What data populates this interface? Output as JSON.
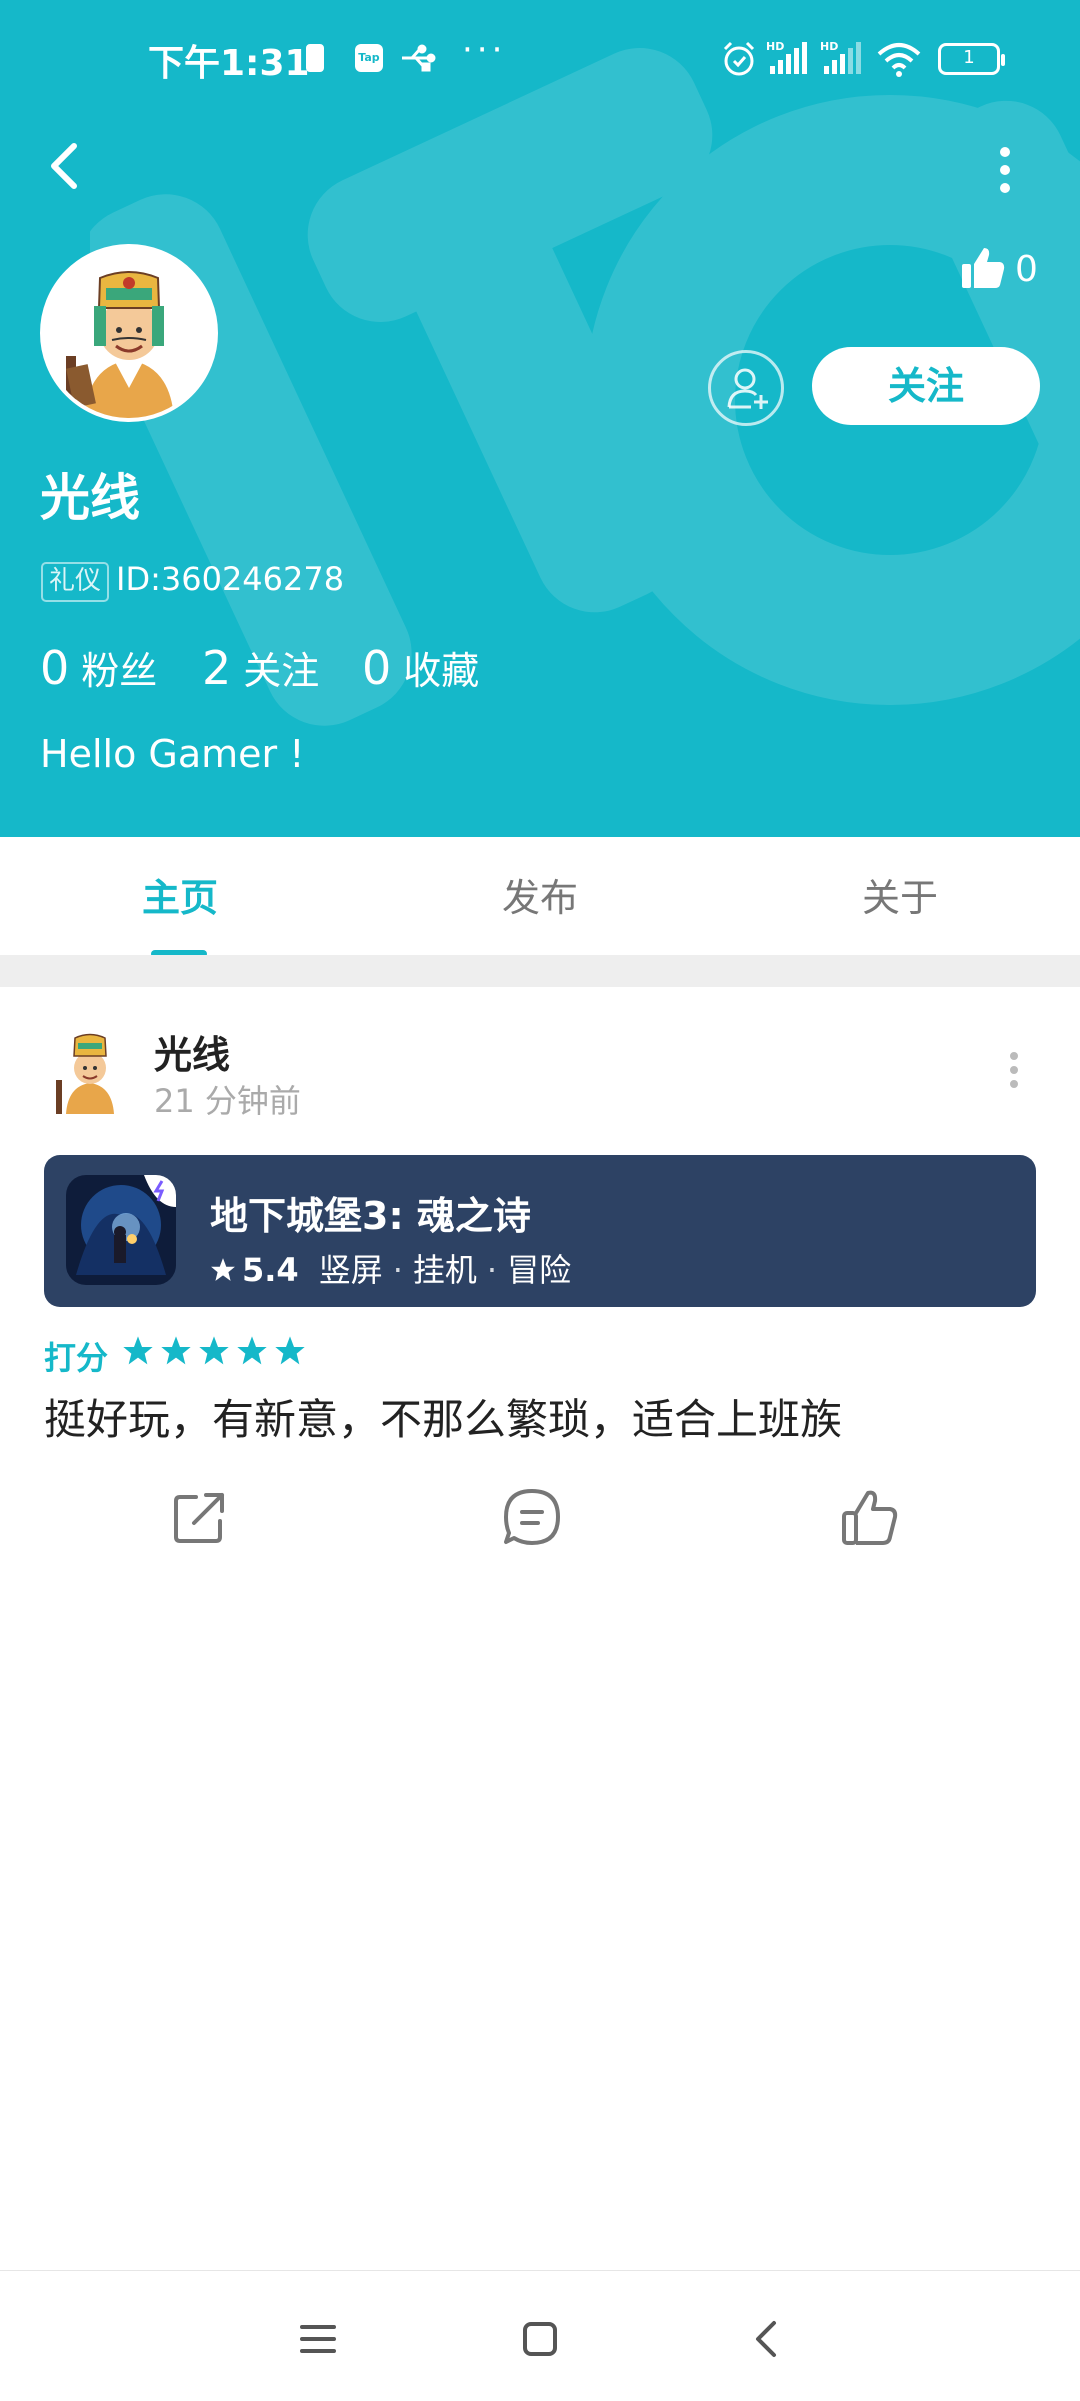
{
  "status_bar": {
    "time": "下午1:31",
    "tap_label": "Tap",
    "dots": "···",
    "battery": "1"
  },
  "profile": {
    "likes": "0",
    "follow_label": "关注",
    "name": "光线",
    "badge": "礼仪",
    "id_text": "ID:360246278",
    "stats": [
      {
        "num": "0",
        "label": "粉丝"
      },
      {
        "num": "2",
        "label": "关注"
      },
      {
        "num": "0",
        "label": "收藏"
      }
    ],
    "bio": "Hello Gamer !"
  },
  "tabs": [
    {
      "label": "主页",
      "active": true
    },
    {
      "label": "发布",
      "active": false
    },
    {
      "label": "关于",
      "active": false
    }
  ],
  "post": {
    "author": "光线",
    "time": "21 分钟前",
    "game": {
      "title": "地下城堡3: 魂之诗",
      "score": "5.4",
      "tags": [
        "竖屏",
        "挂机",
        "冒险"
      ]
    },
    "rating_label": "打分",
    "rating_stars": 5,
    "text": "挺好玩，有新意，不那么繁琐，适合上班族"
  },
  "colors": {
    "accent": "#15b8c9",
    "card": "#2d4264"
  },
  "icons": {
    "back": "back-arrow-icon",
    "more": "more-vertical-icon",
    "like": "thumbs-up-icon",
    "add_friend": "add-friend-icon",
    "share": "share-icon",
    "comment": "comment-icon",
    "nav_menu": "menu-icon",
    "nav_home": "home-square-icon",
    "nav_back": "nav-back-icon"
  }
}
